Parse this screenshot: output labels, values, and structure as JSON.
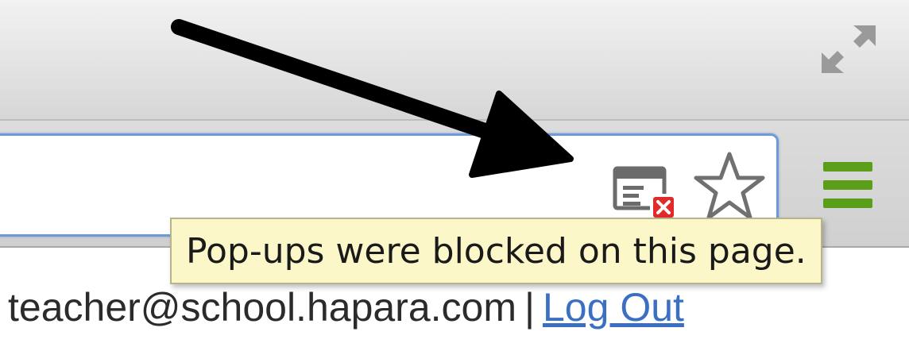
{
  "browser": {
    "toolbar": {
      "popup_blocked_icon": "popup-blocked-icon",
      "bookmark_icon": "star-icon",
      "menu_icon": "hamburger-menu-icon",
      "fullscreen_icon": "fullscreen-icon",
      "menu_icon_color": "#5a9e1a",
      "omnibox_border_color": "#6d9ad9"
    },
    "tooltip": {
      "text": "Pop-ups were blocked on this page."
    }
  },
  "page": {
    "user_email": "teacher@school.hapara.com",
    "separator": "|",
    "logout_label": "Log Out",
    "link_color": "#3a6fc4"
  },
  "annotation": {
    "arrow_color": "#000000"
  }
}
